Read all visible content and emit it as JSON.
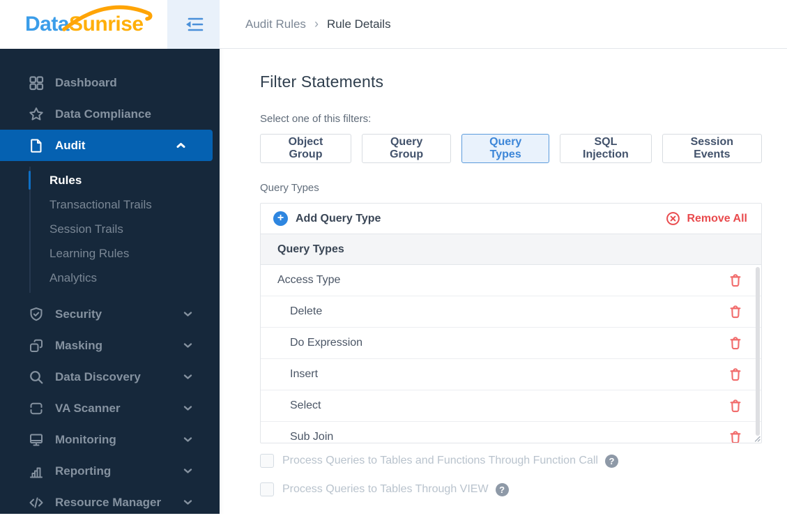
{
  "colors": {
    "sidebar_bg": "#16283b",
    "active_blue": "#0561b1",
    "accent_blue": "#2e86e0",
    "logo_blue": "#3b9de9",
    "logo_orange": "#ffaf0a",
    "danger_red": "#e94b4e",
    "trash_red": "#f16b6b",
    "muted_text": "#8592a0"
  },
  "topbar": {
    "logo": {
      "part1": "Data",
      "part2": "Sunrise",
      "icon": "sunrise-arc-icon"
    },
    "collapse_icon": "collapse-sidebar-icon",
    "breadcrumb": {
      "parent": "Audit Rules",
      "separator": "›",
      "current": "Rule Details"
    }
  },
  "sidebar": {
    "items": [
      {
        "label": "Dashboard",
        "icon": "dashboard-grid-icon",
        "active": false,
        "expandable": false
      },
      {
        "label": "Data Compliance",
        "icon": "star-icon",
        "active": false,
        "expandable": false
      },
      {
        "label": "Audit",
        "icon": "document-icon",
        "active": true,
        "expandable": true,
        "expanded": true
      },
      {
        "label": "Security",
        "icon": "shield-check-icon",
        "active": false,
        "expandable": true
      },
      {
        "label": "Masking",
        "icon": "overlap-squares-icon",
        "active": false,
        "expandable": true
      },
      {
        "label": "Data Discovery",
        "icon": "search-icon",
        "active": false,
        "expandable": true
      },
      {
        "label": "VA Scanner",
        "icon": "scanner-icon",
        "active": false,
        "expandable": true
      },
      {
        "label": "Monitoring",
        "icon": "monitor-icon",
        "active": false,
        "expandable": true
      },
      {
        "label": "Reporting",
        "icon": "bar-chart-icon",
        "active": false,
        "expandable": true
      },
      {
        "label": "Resource Manager",
        "icon": "code-icon",
        "active": false,
        "expandable": true
      }
    ],
    "audit_submenu": [
      "Rules",
      "Transactional Trails",
      "Session Trails",
      "Learning Rules",
      "Analytics"
    ],
    "audit_submenu_active": "Rules"
  },
  "main": {
    "title": "Filter Statements",
    "filter_label": "Select one of this filters:",
    "filters": [
      {
        "label": "Object Group",
        "active": false
      },
      {
        "label": "Query Group",
        "active": false
      },
      {
        "label": "Query Types",
        "active": true
      },
      {
        "label": "SQL Injection",
        "active": false
      },
      {
        "label": "Session Events",
        "active": false
      }
    ],
    "table_label": "Query Types",
    "table": {
      "add_button": "Add Query Type",
      "add_icon": "plus-circle-icon",
      "add_glyph": "+",
      "remove_all_button": "Remove All",
      "remove_icon": "x-circle-icon",
      "column_header": "Query Types",
      "row_action_icon": "trash-icon",
      "rows": [
        {
          "label": "Access Type",
          "indent": false
        },
        {
          "label": "Delete",
          "indent": true
        },
        {
          "label": "Do Expression",
          "indent": true
        },
        {
          "label": "Insert",
          "indent": true
        },
        {
          "label": "Select",
          "indent": true
        },
        {
          "label": "Sub Join",
          "indent": true
        }
      ]
    },
    "checkboxes": [
      {
        "label": "Process Queries to Tables and Functions Through Function Call",
        "checked": false,
        "disabled": true,
        "help_icon": "question-icon"
      },
      {
        "label": "Process Queries to Tables Through VIEW",
        "checked": false,
        "disabled": true,
        "help_icon": "question-icon"
      }
    ],
    "help_glyph": "?"
  }
}
